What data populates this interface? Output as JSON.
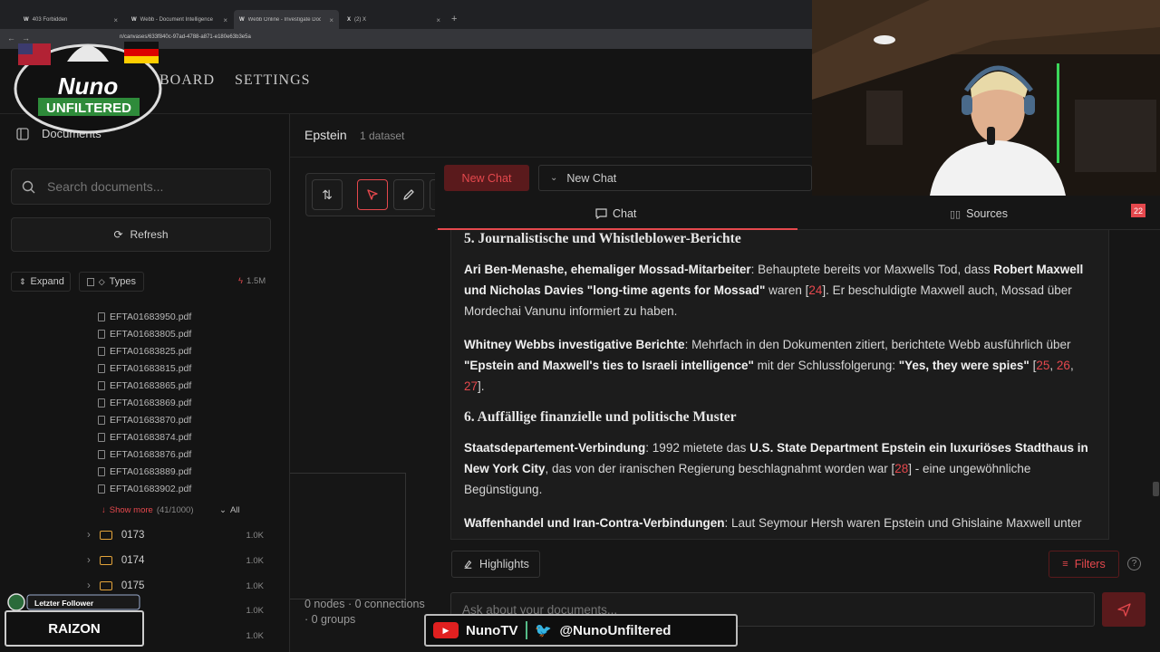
{
  "browser": {
    "tabs": [
      {
        "label": "403 Forbidden"
      },
      {
        "label": "Webb - Document Intelligence"
      },
      {
        "label": "Webb Online - Investigate Doc"
      },
      {
        "label": "(2) X"
      }
    ],
    "url": "n/canvases/633f840c-97ad-4788-a871-e180e63b3e5a"
  },
  "topnav": {
    "items": [
      "BOARD",
      "SETTINGS"
    ]
  },
  "sidebar": {
    "title": "Documents",
    "search_placeholder": "Search documents...",
    "refresh_label": "Refresh",
    "expand_label": "Expand",
    "types_label": "Types",
    "count_label": "1.5M",
    "files": [
      "EFTA01683950.pdf",
      "EFTA01683805.pdf",
      "EFTA01683825.pdf",
      "EFTA01683815.pdf",
      "EFTA01683865.pdf",
      "EFTA01683869.pdf",
      "EFTA01683870.pdf",
      "EFTA01683874.pdf",
      "EFTA01683876.pdf",
      "EFTA01683889.pdf",
      "EFTA01683902.pdf"
    ],
    "show_more": "Show more",
    "show_more_count": "(41/1000)",
    "all_label": "All",
    "folders": [
      {
        "name": "0173",
        "size": "1.0K"
      },
      {
        "name": "0174",
        "size": "1.0K"
      },
      {
        "name": "0175",
        "size": "1.0K"
      },
      {
        "name": "",
        "size": "1.0K"
      },
      {
        "name": "",
        "size": "1.0K"
      }
    ]
  },
  "canvas": {
    "title": "Epstein",
    "dataset_count": "1 dataset",
    "stats": "0 nodes · 0 connections · 0 groups"
  },
  "chat": {
    "new_chat_button": "New Chat",
    "selected_chat": "New Chat",
    "tab_chat": "Chat",
    "tab_sources": "Sources",
    "badge": "22",
    "highlights_label": "Highlights",
    "filters_label": "Filters",
    "ask_placeholder": "Ask about your documents..."
  },
  "message": {
    "h5": "5. Journalistische und Whistleblower-Berichte",
    "p1_b1": "Ari Ben-Menashe, ehemaliger Mossad-Mitarbeiter",
    "p1_t1": ": Behauptete bereits vor Maxwells Tod, dass ",
    "p1_b2": "Robert Maxwell und Nicholas Davies \"long-time agents for Mossad\"",
    "p1_t2": " waren [",
    "p1_r1": "24",
    "p1_t3": "]. Er beschuldigte Maxwell auch, Mossad über Mordechai Vanunu informiert zu haben.",
    "p2_b1": "Whitney Webbs investigative Berichte",
    "p2_t1": ": Mehrfach in den Dokumenten zitiert, berichtete Webb ausführlich über ",
    "p2_b2": "\"Epstein and Maxwell's ties to Israeli intelligence\"",
    "p2_t2": " mit der Schlussfolgerung: ",
    "p2_b3": "\"Yes, they were spies\"",
    "p2_t3": " [",
    "p2_r1": "25",
    "p2_r2": "26",
    "p2_r3": "27",
    "p2_t4": "].",
    "h6": "6. Auffällige finanzielle und politische Muster",
    "p3_b1": "Staatsdepartement-Verbindung",
    "p3_t1": ": 1992 mietete das ",
    "p3_b2": "U.S. State Department Epstein ein luxuriöses Stadthaus in New York City",
    "p3_t2": ", das von der iranischen Regierung beschlagnahmt worden war [",
    "p3_r1": "28",
    "p3_t3": "] - eine ungewöhnliche Begünstigung.",
    "p4_b1": "Waffenhandel und Iran-Contra-Verbindungen",
    "p4_t1": ": Laut Seymour Hersh waren Epstein und Ghislaine Maxwell unter Robert Maxwell's Führung an \"a clandestine operation involving arms dealing, blackmail"
  },
  "overlay": {
    "logo_line1": "Nuno",
    "logo_line2": "UNFILTERED",
    "follower_title": "Letzter Follower",
    "follower_name": "RAIZON",
    "yt_handle": "NunoTV",
    "tw_handle": "@NunoUnfiltered"
  },
  "colors": {
    "accent": "#e5484d",
    "background": "#161616",
    "panel": "#1c1c1c"
  }
}
